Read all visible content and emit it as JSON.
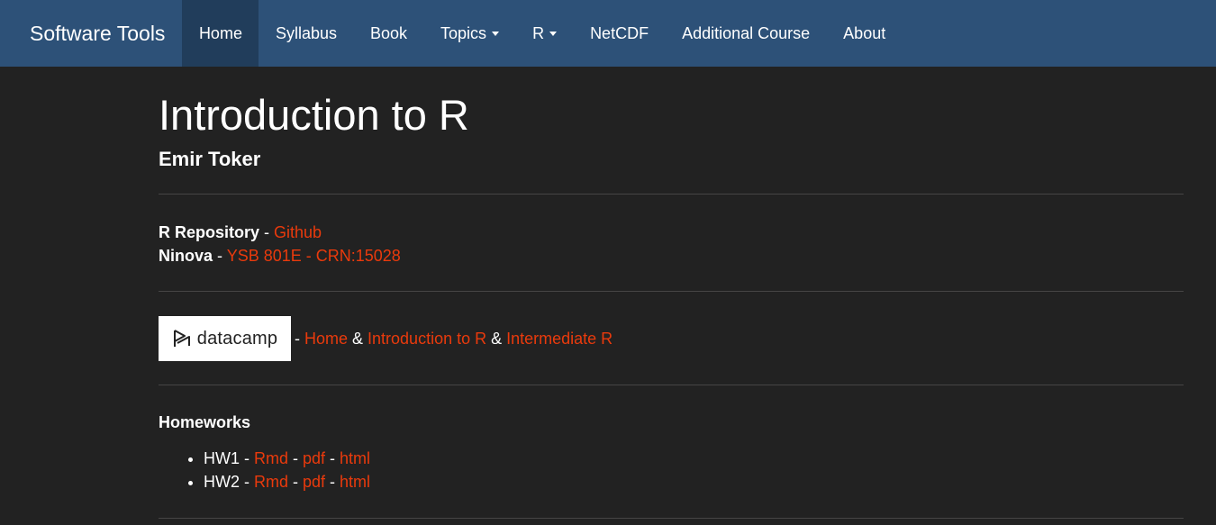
{
  "navbar": {
    "brand": "Software Tools",
    "items": [
      {
        "label": "Home",
        "active": true,
        "dropdown": false
      },
      {
        "label": "Syllabus",
        "active": false,
        "dropdown": false
      },
      {
        "label": "Book",
        "active": false,
        "dropdown": false
      },
      {
        "label": "Topics",
        "active": false,
        "dropdown": true
      },
      {
        "label": "R",
        "active": false,
        "dropdown": true
      },
      {
        "label": "NetCDF",
        "active": false,
        "dropdown": false
      },
      {
        "label": "Additional Course",
        "active": false,
        "dropdown": false
      },
      {
        "label": "About",
        "active": false,
        "dropdown": false
      }
    ]
  },
  "page": {
    "title": "Introduction to R",
    "author": "Emir Toker"
  },
  "repo": {
    "r_label": "R Repository",
    "r_sep": " - ",
    "r_link": "Github",
    "ninova_label": "Ninova",
    "ninova_sep": " - ",
    "ninova_link": "YSB 801E - CRN:15028"
  },
  "datacamp": {
    "logo_text": "datacamp",
    "sep": " - ",
    "link_home": "Home",
    "amp1": " & ",
    "link_intro": "Introduction to R",
    "amp2": " & ",
    "link_intermediate": "Intermediate R"
  },
  "homeworks": {
    "title": "Homeworks",
    "items": [
      {
        "name": "HW1",
        "rmd": "Rmd",
        "pdf": "pdf",
        "html": "html"
      },
      {
        "name": "HW2",
        "rmd": "Rmd",
        "pdf": "pdf",
        "html": "html"
      }
    ],
    "sep": " - "
  },
  "colors": {
    "navbar_bg": "#2d5178",
    "navbar_active": "#213d5b",
    "page_bg": "#222222",
    "link": "#ea3a0c",
    "text": "#ffffff"
  }
}
